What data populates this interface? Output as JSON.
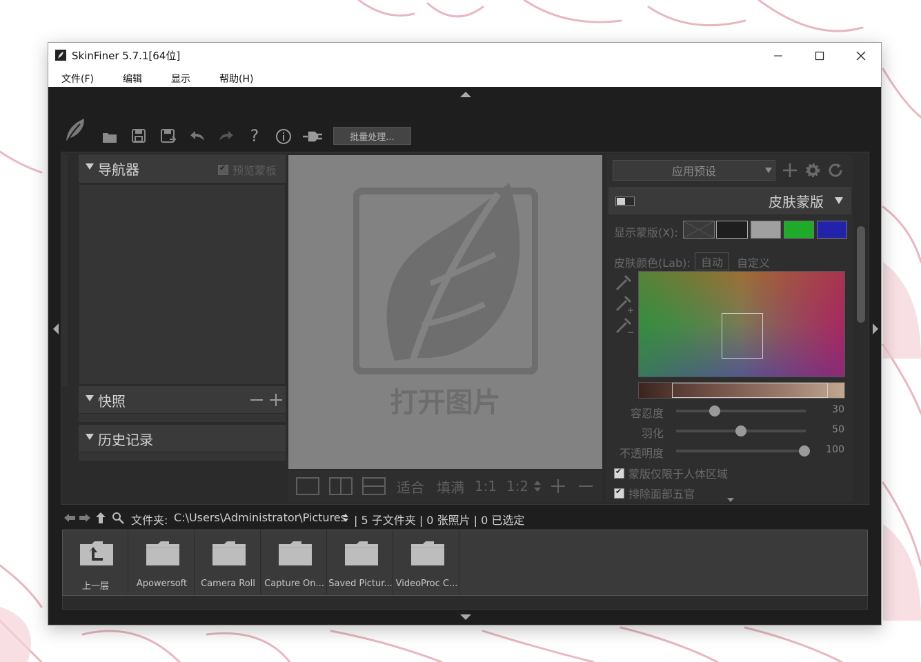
{
  "window": {
    "title": "SkinFiner 5.7.1[64位]"
  },
  "menu": {
    "items": [
      "文件(F)",
      "编辑",
      "显示",
      "帮助(H)"
    ]
  },
  "toolbar": {
    "icons": [
      "app-leaf-icon",
      "open-folder-icon",
      "save-icon",
      "save-as-icon",
      "undo-icon",
      "redo-icon",
      "help-icon",
      "info-icon",
      "plugin-icon"
    ],
    "batch_label": "批量处理..."
  },
  "navigator": {
    "title": "导航器",
    "preview_mask_label": "预览蒙板",
    "preview_mask_checked": true
  },
  "snapshot": {
    "title": "快照"
  },
  "history": {
    "title": "历史记录"
  },
  "canvas": {
    "placeholder": "打开图片"
  },
  "view_bar": {
    "fit": "适合",
    "fill": "填满",
    "ratio_1_1": "1:1",
    "ratio_1_2": "1:2"
  },
  "presets": {
    "selected": "应用预设"
  },
  "skin_mask": {
    "title": "皮肤蒙版",
    "show_mask_label": "显示蒙版(X):",
    "swatch_colors": [
      "#3a3a3a",
      "#1e1e1e",
      "#a0a0a0",
      "#1faa2a",
      "#2222aa"
    ],
    "skin_color_label": "皮肤颜色(Lab):",
    "auto_label": "自动",
    "custom_label": "自定义"
  },
  "sliders": [
    {
      "label": "容忍度",
      "value": "30",
      "level": 0.3
    },
    {
      "label": "羽化",
      "value": "50",
      "level": 0.5
    },
    {
      "label": "不透明度",
      "value": "100",
      "level": 1.0
    }
  ],
  "checks": [
    {
      "label": "蒙版仅限于人体区域",
      "checked": true
    },
    {
      "label": "排除面部五官",
      "checked": true
    }
  ],
  "file_browser": {
    "folder_prefix": "文件夹:",
    "path": "C:\\Users\\Administrator\\Pictures",
    "stats": "| 5 子文件夹 | 0 张照片 | 0 已选定",
    "items": [
      "上一层",
      "Apowersoft",
      "Camera Roll",
      "Capture On...",
      "Saved Pictur...",
      "VideoProc C..."
    ]
  }
}
